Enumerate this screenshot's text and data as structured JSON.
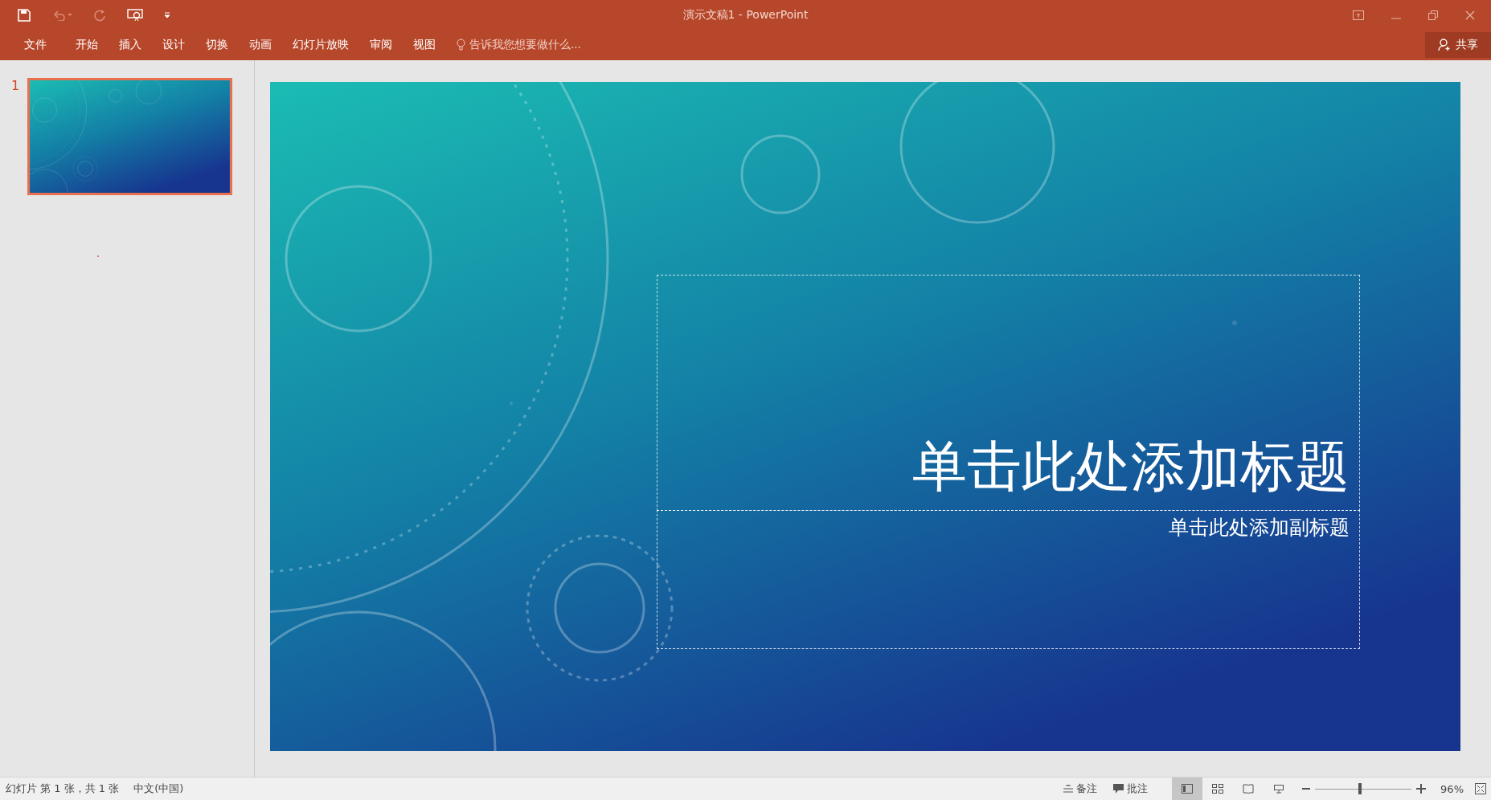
{
  "window": {
    "title": "演示文稿1 - PowerPoint"
  },
  "ribbon_tabs": [
    {
      "label": "文件"
    },
    {
      "label": "开始"
    },
    {
      "label": "插入"
    },
    {
      "label": "设计"
    },
    {
      "label": "切换"
    },
    {
      "label": "动画"
    },
    {
      "label": "幻灯片放映"
    },
    {
      "label": "审阅"
    },
    {
      "label": "视图"
    }
  ],
  "tell_me": {
    "placeholder": "告诉我您想要做什么..."
  },
  "share": {
    "label": "共享"
  },
  "slides": [
    {
      "number": "1",
      "selected": true
    }
  ],
  "slide": {
    "title_placeholder": "单击此处添加标题",
    "subtitle_placeholder": "单击此处添加副标题"
  },
  "status_bar": {
    "slide_info": "幻灯片 第 1 张，共 1 张",
    "language": "中文(中国)",
    "notes": "备注",
    "comments": "批注",
    "views": [
      {
        "kind": "normal",
        "selected": true
      },
      {
        "kind": "sorter",
        "selected": false
      },
      {
        "kind": "reading",
        "selected": false
      },
      {
        "kind": "show",
        "selected": false
      }
    ],
    "zoom": {
      "level": 0.47,
      "reading": "96%"
    }
  }
}
